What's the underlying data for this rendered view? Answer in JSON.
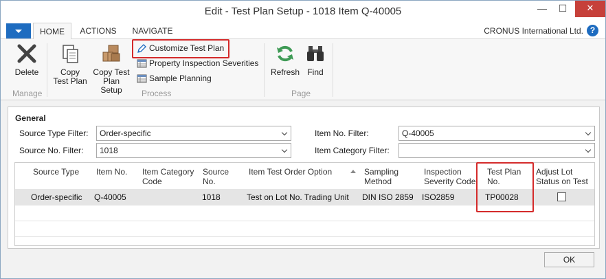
{
  "window": {
    "title": "Edit - Test Plan Setup - 1018  Item Q-40005",
    "minimize_icon": "minimize-icon",
    "maximize_icon": "maximize-icon",
    "close_icon": "close-icon"
  },
  "menu": {
    "tabs": [
      {
        "label": "HOME",
        "active": true
      },
      {
        "label": "ACTIONS",
        "active": false
      },
      {
        "label": "NAVIGATE",
        "active": false
      }
    ],
    "company": "CRONUS International Ltd."
  },
  "ribbon": {
    "manage": {
      "label": "Manage",
      "delete_label": "Delete"
    },
    "process": {
      "label": "Process",
      "copy_test_plan_label": "Copy Test Plan",
      "copy_test_plan_setup_label": "Copy Test Plan Setup",
      "customize_label": "Customize Test Plan",
      "property_label": "Property Inspection Severities",
      "sample_label": "Sample Planning"
    },
    "page": {
      "label": "Page",
      "refresh_label": "Refresh",
      "find_label": "Find"
    }
  },
  "general": {
    "title": "General",
    "source_type_filter_label": "Source Type Filter:",
    "source_type_filter_value": "Order-specific",
    "source_no_filter_label": "Source No. Filter:",
    "source_no_filter_value": "1018",
    "item_no_filter_label": "Item No. Filter:",
    "item_no_filter_value": "Q-40005",
    "item_category_filter_label": "Item Category Filter:",
    "item_category_filter_value": ""
  },
  "grid": {
    "headers": {
      "source_type": "Source Type",
      "item_no": "Item No.",
      "item_category_code_1": "Item Category",
      "item_category_code_2": "Code",
      "source_no_1": "Source",
      "source_no_2": "No.",
      "test_order_option": "Item Test Order Option",
      "sampling_method_1": "Sampling",
      "sampling_method_2": "Method",
      "inspection_severity_1": "Inspection",
      "inspection_severity_2": "Severity Code",
      "test_plan_no_1": "Test Plan",
      "test_plan_no_2": "No.",
      "adjust_lot_1": "Adjust Lot",
      "adjust_lot_2": "Status on Test"
    },
    "rows": [
      {
        "source_type": "Order-specific",
        "item_no": "Q-40005",
        "item_category_code": "",
        "source_no": "1018",
        "test_order_option": "Test on Lot No. Trading Unit",
        "sampling_method": "DIN ISO 2859",
        "inspection_severity": "ISO2859",
        "test_plan_no": "TP00028",
        "adjust_lot_status": false
      }
    ]
  },
  "footer": {
    "ok_label": "OK"
  },
  "colors": {
    "accent": "#1e6cc0",
    "highlight": "#d42a2a",
    "close": "#c6403a"
  }
}
